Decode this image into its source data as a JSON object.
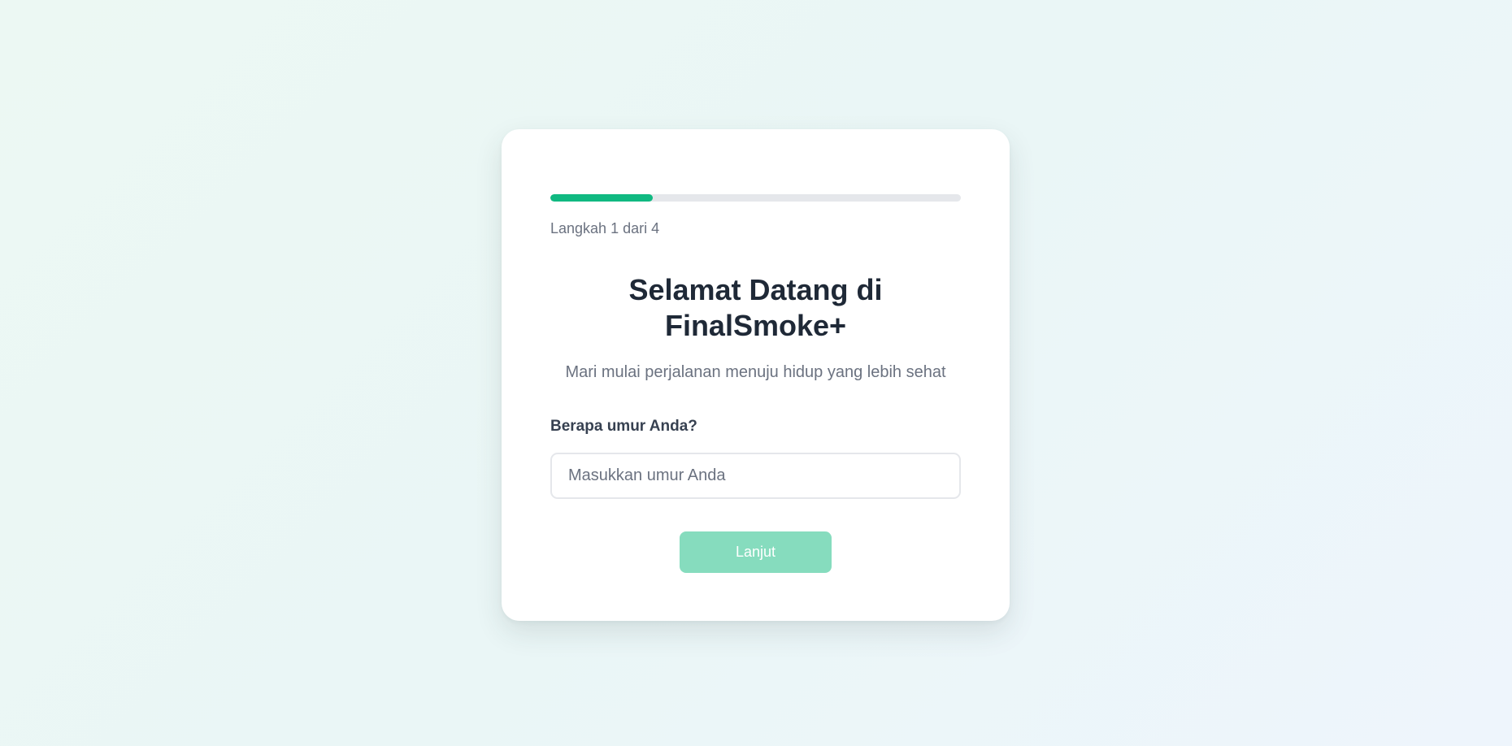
{
  "progress": {
    "current_step": 1,
    "total_steps": 4,
    "fill_fraction": 0.25,
    "label": "Langkah 1 dari 4",
    "fill_color": "#10b981",
    "track_color": "#e5e7eb"
  },
  "welcome": {
    "title": "Selamat Datang di FinalSmoke+",
    "subtitle": "Mari mulai perjalanan menuju hidup yang lebih sehat"
  },
  "form": {
    "question_label": "Berapa umur Anda?",
    "age_input": {
      "value": "",
      "placeholder": "Masukkan umur Anda"
    },
    "next_button": {
      "label": "Lanjut",
      "color": "#86dcbe"
    }
  }
}
